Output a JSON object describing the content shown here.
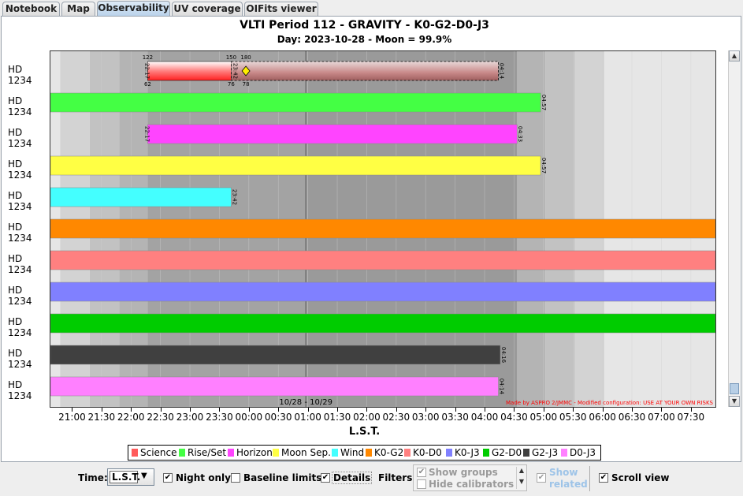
{
  "tabs": [
    "Notebook",
    "Map",
    "Observability",
    "UV coverage",
    "OIFits viewer"
  ],
  "chart": {
    "title": "VLTI Period 112 - GRAVITY - K0-G2-D0-J3",
    "subtitle": "Day: 2023-10-28 - Moon = 99.9%",
    "xlabel": "L.S.T.",
    "midnight_label": "10/28 - 10/29",
    "credit": "Made by ASPRO 2/JMMC - Modified configuration: USE AT YOUR OWN RISKS"
  },
  "chart_data": {
    "type": "timeline",
    "x_ticks": [
      "21:00",
      "21:30",
      "22:00",
      "22:30",
      "23:00",
      "23:30",
      "00:00",
      "00:30",
      "01:00",
      "01:30",
      "02:00",
      "02:30",
      "03:00",
      "03:30",
      "04:00",
      "04:30",
      "05:00",
      "05:30",
      "06:00",
      "06:30",
      "07:00",
      "07:30"
    ],
    "rows": [
      {
        "label": "HD 1234",
        "category": "Science",
        "color": "#ff5a5a",
        "start": "20:38",
        "end": "04:14",
        "start_label": "22:17",
        "mid_label": "23:42",
        "end_label": "04:14",
        "top_values": [
          "122",
          "150",
          "180"
        ],
        "bottom_values": [
          "62",
          "76",
          "78"
        ]
      },
      {
        "label": "HD 1234",
        "category": "Rise/Set",
        "color": "#44ff44",
        "start": "20:38",
        "end": "04:57",
        "end_label": "04:57"
      },
      {
        "label": "HD 1234",
        "category": "Horizon",
        "color": "#ff44ff",
        "start": "22:17",
        "end": "04:33",
        "start_label": "22:17",
        "end_label": "04:33"
      },
      {
        "label": "HD 1234",
        "category": "Moon Sep.",
        "color": "#ffff44",
        "start": "20:38",
        "end": "04:57",
        "end_label": "04:57"
      },
      {
        "label": "HD 1234",
        "category": "Wind",
        "color": "#44ffff",
        "start": "20:38",
        "end": "23:42",
        "end_label": "23:42"
      },
      {
        "label": "HD 1234",
        "category": "K0-G2",
        "color": "#ff8800",
        "start": "20:38",
        "end": "07:55"
      },
      {
        "label": "HD 1234",
        "category": "K0-D0",
        "color": "#ff8080",
        "start": "20:38",
        "end": "07:55"
      },
      {
        "label": "HD 1234",
        "category": "K0-J3",
        "color": "#8080ff",
        "start": "20:38",
        "end": "07:55"
      },
      {
        "label": "HD 1234",
        "category": "G2-D0",
        "color": "#00cc00",
        "start": "20:38",
        "end": "07:55"
      },
      {
        "label": "HD 1234",
        "category": "G2-J3",
        "color": "#404040",
        "start": "20:38",
        "end": "04:16",
        "end_label": "04:16"
      },
      {
        "label": "HD 1234",
        "category": "D0-J3",
        "color": "#ff80ff",
        "start": "20:38",
        "end": "04:14",
        "end_label": "04:14"
      }
    ],
    "legend": [
      {
        "label": "Science",
        "color": "#ff5a5a"
      },
      {
        "label": "Rise/Set",
        "color": "#44ff44"
      },
      {
        "label": "Horizon",
        "color": "#ff44ff"
      },
      {
        "label": "Moon Sep.",
        "color": "#ffff44"
      },
      {
        "label": "Wind",
        "color": "#44ffff"
      },
      {
        "label": "K0-G2",
        "color": "#ff8800"
      },
      {
        "label": "K0-D0",
        "color": "#ff8080"
      },
      {
        "label": "K0-J3",
        "color": "#8080ff"
      },
      {
        "label": "G2-D0",
        "color": "#00cc00"
      },
      {
        "label": "G2-J3",
        "color": "#404040"
      },
      {
        "label": "D0-J3",
        "color": "#ff80ff"
      }
    ]
  },
  "controls": {
    "time_label": "Time:",
    "time_value": "L.S.T.",
    "night_only": "Night only",
    "night_only_checked": true,
    "baseline_limits": "Baseline limits",
    "baseline_limits_checked": false,
    "details": "Details",
    "details_checked": true,
    "filters_label": "Filters:",
    "show_groups": "Show groups",
    "hide_calibrators": "Hide calibrators",
    "show_related": "Show related",
    "scroll_view": "Scroll view",
    "scroll_view_checked": true
  }
}
